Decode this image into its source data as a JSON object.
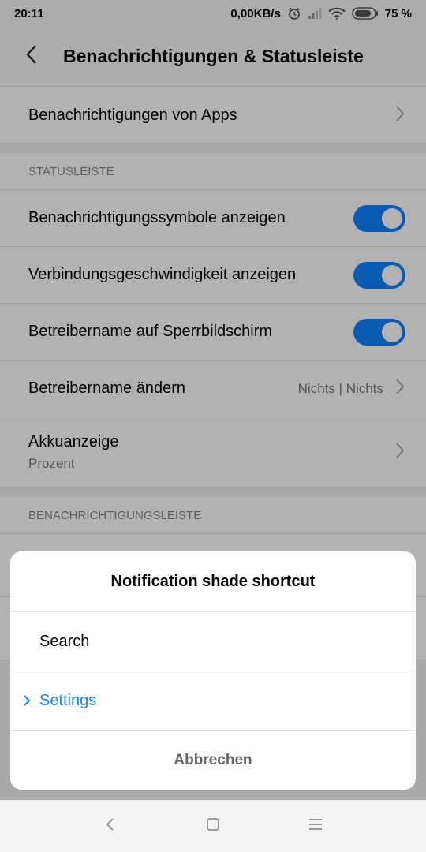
{
  "status_bar": {
    "time": "20:11",
    "speed": "0,00KB/s",
    "battery": "75 %",
    "icons": [
      "alarm-icon",
      "signal-icon",
      "wifi-icon",
      "battery-icon"
    ]
  },
  "header": {
    "title": "Benachrichtigungen & Statusleiste",
    "back_icon": "chevron-left-icon"
  },
  "settings": {
    "apps_notifications": "Benachrichtigungen von Apps",
    "status_section": "STATUSLEISTE",
    "toggles": [
      {
        "label": "Benachrichtigungssymbole anzeigen",
        "on": true
      },
      {
        "label": "Verbindungsgeschwindigkeit anzeigen",
        "on": true
      },
      {
        "label": "Betreibername auf Sperrbildschirm",
        "on": true
      }
    ],
    "carrier_name": {
      "label": "Betreibername ändern",
      "value": "Nichts | Nichts"
    },
    "battery_indicator": {
      "label": "Akkuanzeige",
      "value": "Prozent"
    },
    "shade_section": "BENACHRICHTIGUNGSLEISTE"
  },
  "dialog": {
    "title": "Notification shade shortcut",
    "options": [
      {
        "label": "Search",
        "selected": false
      },
      {
        "label": "Settings",
        "selected": true
      }
    ],
    "cancel": "Abbrechen"
  },
  "nav_bar": {
    "icons": [
      "back-icon",
      "home-icon",
      "menu-icon"
    ]
  },
  "colors": {
    "accent": "#0d84ff",
    "scrim": "rgba(0,0,0,0.30)"
  }
}
